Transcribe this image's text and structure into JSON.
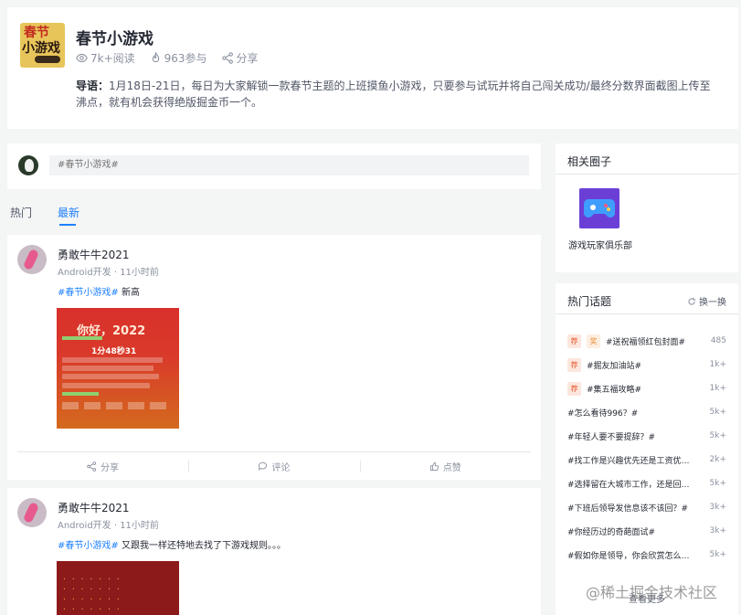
{
  "topic": {
    "cover_line1": "春节",
    "cover_line2": "小游戏",
    "title": "春节小游戏",
    "views": "7k+阅读",
    "participants": "963参与",
    "share": "分享",
    "desc_label": "导语：",
    "description": "1月18日-21日，每日为大家解锁一款春节主题的上班摸鱼小游戏，只要参与试玩并将自己闯关成功/最终分数界面截图上传至沸点，就有机会获得绝版掘金币一个。"
  },
  "composer": {
    "placeholder": "#春节小游戏#"
  },
  "tabs": [
    {
      "label": "热门"
    },
    {
      "label": "最新"
    }
  ],
  "posts": [
    {
      "author": "勇敢牛牛2021",
      "meta": "Android开发 · 11小时前",
      "tag": "#春节小游戏#",
      "text": " 新高",
      "image_title": "你好，2022",
      "image_score": "1分48秒31",
      "actions": {
        "share": "分享",
        "comment": "评论",
        "like": "点赞"
      }
    },
    {
      "author": "勇敢牛牛2021",
      "meta": "Android开发 · 11小时前",
      "tag": "#春节小游戏#",
      "text": " 又跟我一样还特地去找了下游戏规则。。。"
    }
  ],
  "sidebar": {
    "related_title": "相关圈子",
    "club_name": "游戏玩家俱乐部",
    "hot_title": "热门话题",
    "refresh": "换一换",
    "topics": [
      {
        "badges": [
          "荐",
          "奖"
        ],
        "name": "#送祝福领红包封面#",
        "count": "485"
      },
      {
        "badges": [
          "荐"
        ],
        "name": "#掘友加油站#",
        "count": "1k+"
      },
      {
        "badges": [
          "荐"
        ],
        "name": "#集五福攻略#",
        "count": "1k+"
      },
      {
        "badges": [],
        "name": "#怎么看待996？#",
        "count": "5k+"
      },
      {
        "badges": [],
        "name": "#年轻人要不要提辞？#",
        "count": "5k+"
      },
      {
        "badges": [],
        "name": "#找工作是兴趣优先还是工资优先？#",
        "count": "2k+"
      },
      {
        "badges": [],
        "name": "#选择留在大城市工作，还是回老家？#",
        "count": "5k+"
      },
      {
        "badges": [],
        "name": "#下班后领导发信息该不该回？#",
        "count": "3k+"
      },
      {
        "badges": [],
        "name": "#你经历过的奇葩面试#",
        "count": "3k+"
      },
      {
        "badges": [],
        "name": "#假如你是领导，你会欣赏怎么样的员工？#",
        "count": "5k+"
      }
    ],
    "view_all": "查看更多"
  },
  "watermark": "@稀土掘金技术社区"
}
